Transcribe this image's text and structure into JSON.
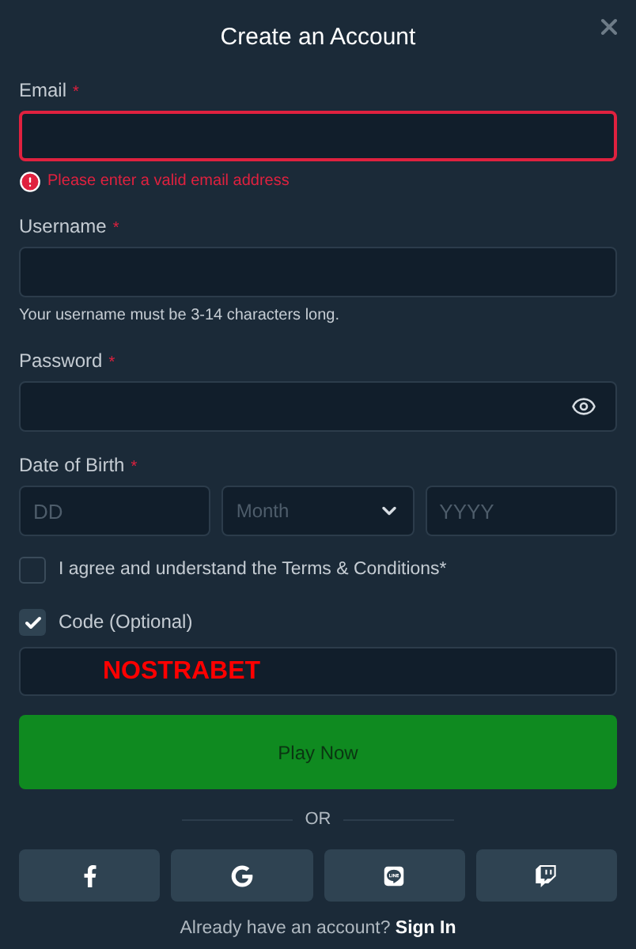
{
  "dialog": {
    "title": "Create an Account"
  },
  "fields": [
    {
      "kind": "text",
      "label": "Email",
      "required_mark": "*",
      "invalid": true,
      "error": "Please enter a valid email address"
    },
    {
      "kind": "text",
      "label": "Username",
      "required_mark": "*",
      "invalid": false,
      "hint": "Your username must be 3-14 characters long."
    },
    {
      "kind": "password",
      "label": "Password",
      "required_mark": "*",
      "invalid": false
    },
    {
      "kind": "date",
      "label": "Date of Birth",
      "required_mark": "*",
      "invalid": false,
      "parts": [
        {
          "kind": "input",
          "placeholder": "DD"
        },
        {
          "kind": "select",
          "placeholder": "Month"
        },
        {
          "kind": "input",
          "placeholder": "YYYY"
        }
      ]
    }
  ],
  "terms": {
    "label": "I agree and understand the Terms & Conditions*",
    "checked": false
  },
  "code": {
    "label": "Code (Optional)",
    "checked": true,
    "value": "NOSTRABET"
  },
  "submit": "Play Now",
  "divider": "OR",
  "social": [
    {
      "kind": "facebook"
    },
    {
      "kind": "google"
    },
    {
      "kind": "line"
    },
    {
      "kind": "twitch"
    }
  ],
  "footer": {
    "text": "Already have an account?",
    "link": "Sign In"
  }
}
